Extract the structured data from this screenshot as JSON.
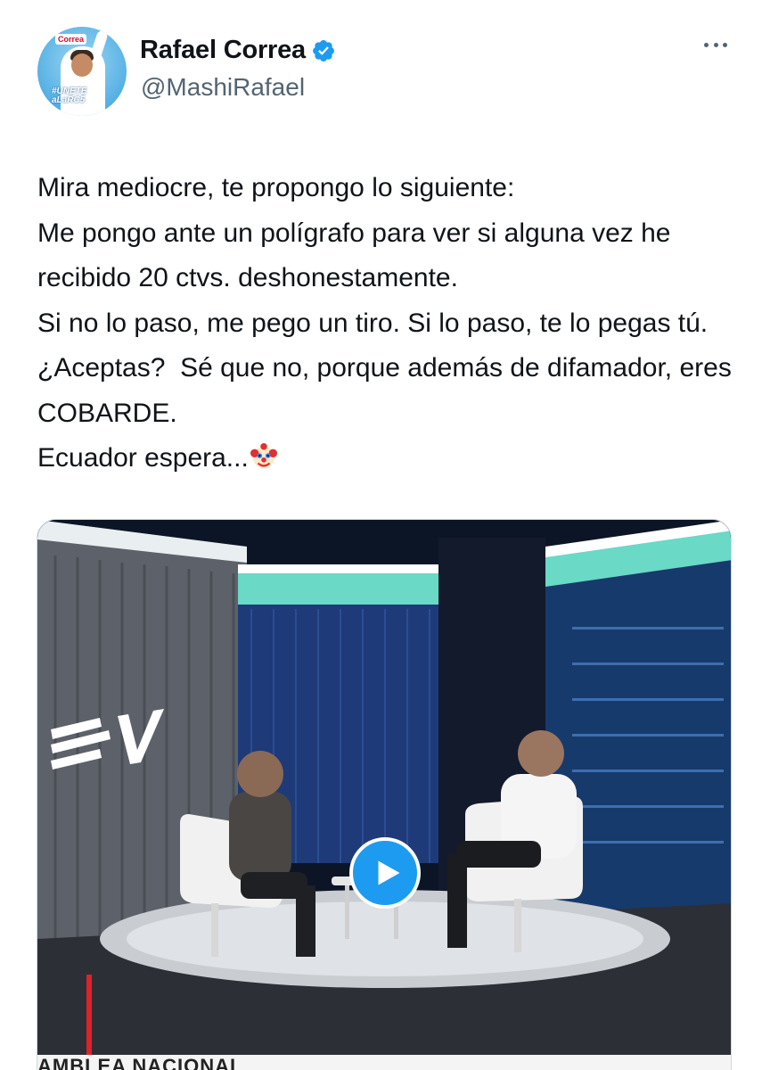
{
  "author": {
    "name": "Rafael Correa",
    "handle": "@MashiRafael",
    "avatar_brand": "Correa",
    "avatar_tag_line1": "#UNETE",
    "avatar_tag_line2": "aLaRC5",
    "verified_icon": "verified-badge-icon"
  },
  "tweet": {
    "text": "Mira mediocre, te propongo lo siguiente:\nMe pongo ante un polígrafo para ver si alguna vez he recibido 20 ctvs. deshonestamente.\nSi no lo paso, me pego un tiro. Si lo paso, te lo pegas tú. ¿Aceptas?  Sé que no, porque además de difamador, eres COBARDE.\nEcuador espera...",
    "emoji": "clown-face-icon"
  },
  "media": {
    "type": "video",
    "play_icon": "play-icon",
    "lower_third_text": "AMBLEA NACIONAL",
    "accent_color": "#1d9bf0"
  },
  "colors": {
    "text_primary": "#0f1419",
    "text_secondary": "#536471",
    "verified": "#1d9bf0"
  }
}
